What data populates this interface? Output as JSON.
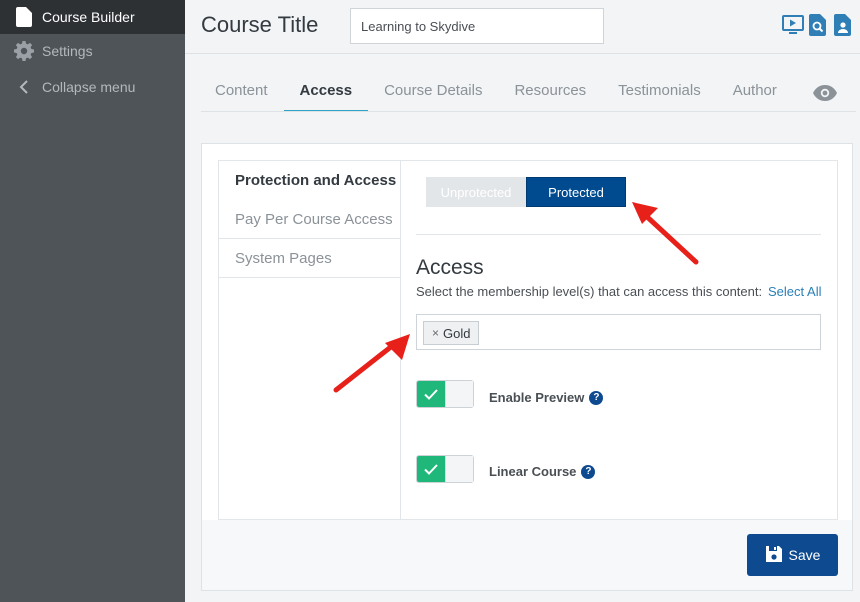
{
  "sidebar": {
    "items": [
      {
        "label": "Course Builder",
        "icon": "document-icon"
      },
      {
        "label": "Settings",
        "icon": "gear-icon"
      },
      {
        "label": "Collapse menu",
        "icon": "chevron-left-icon"
      }
    ]
  },
  "header": {
    "title": "Course Title",
    "course_name_value": "Learning to Skydive",
    "icons": [
      "video-icon",
      "search-doc-icon",
      "user-doc-icon"
    ]
  },
  "tabs": [
    {
      "label": "Content"
    },
    {
      "label": "Access"
    },
    {
      "label": "Course Details"
    },
    {
      "label": "Resources"
    },
    {
      "label": "Testimonials"
    },
    {
      "label": "Author"
    }
  ],
  "subnav": [
    {
      "label": "Protection and Access"
    },
    {
      "label": "Pay Per Course Access"
    },
    {
      "label": "System Pages"
    }
  ],
  "protection": {
    "unprotected_label": "Unprotected",
    "protected_label": "Protected",
    "selected": "Protected"
  },
  "access": {
    "heading": "Access",
    "description": "Select the membership level(s) that can access this content:",
    "select_all": "Select All",
    "levels": [
      {
        "label": "Gold",
        "remove": "×"
      }
    ]
  },
  "settings": {
    "enable_preview_label": "Enable Preview",
    "linear_course_label": "Linear Course",
    "help_glyph": "?"
  },
  "footer": {
    "save_label": "Save"
  },
  "colors": {
    "accent": "#0d4a8f",
    "tab_underline": "#2ea3c5",
    "toggle_on": "#1fb87a",
    "arrow": "#e8201a"
  }
}
